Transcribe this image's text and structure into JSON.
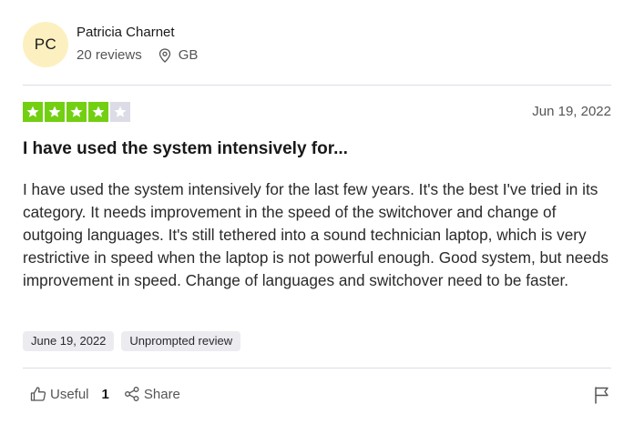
{
  "reviewer": {
    "initials": "PC",
    "name": "Patricia Charnet",
    "reviews_count": "20 reviews",
    "location": "GB"
  },
  "review": {
    "rating": 4,
    "rating_max": 5,
    "date": "Jun 19, 2022",
    "title": "I have used the system intensively for...",
    "body": "I have used the system intensively for the last few years. It's the best I've tried in its category. It needs improvement in the speed of the switchover and change of outgoing languages. It's still tethered into a sound technician laptop, which is very restrictive in speed when the laptop is not powerful enough. Good system, but needs improvement in speed. Change of languages and switchover need to be faster.",
    "tags": [
      "June 19, 2022",
      "Unprompted review"
    ]
  },
  "actions": {
    "useful_label": "Useful",
    "useful_count": "1",
    "share_label": "Share"
  },
  "colors": {
    "star_filled": "#73cf11",
    "star_empty": "#dcdce6",
    "avatar_bg": "#fcf0c0"
  },
  "icons": {
    "location": "location-pin-icon",
    "useful": "thumbs-up-icon",
    "share": "share-icon",
    "flag": "flag-icon",
    "star": "star-icon"
  }
}
